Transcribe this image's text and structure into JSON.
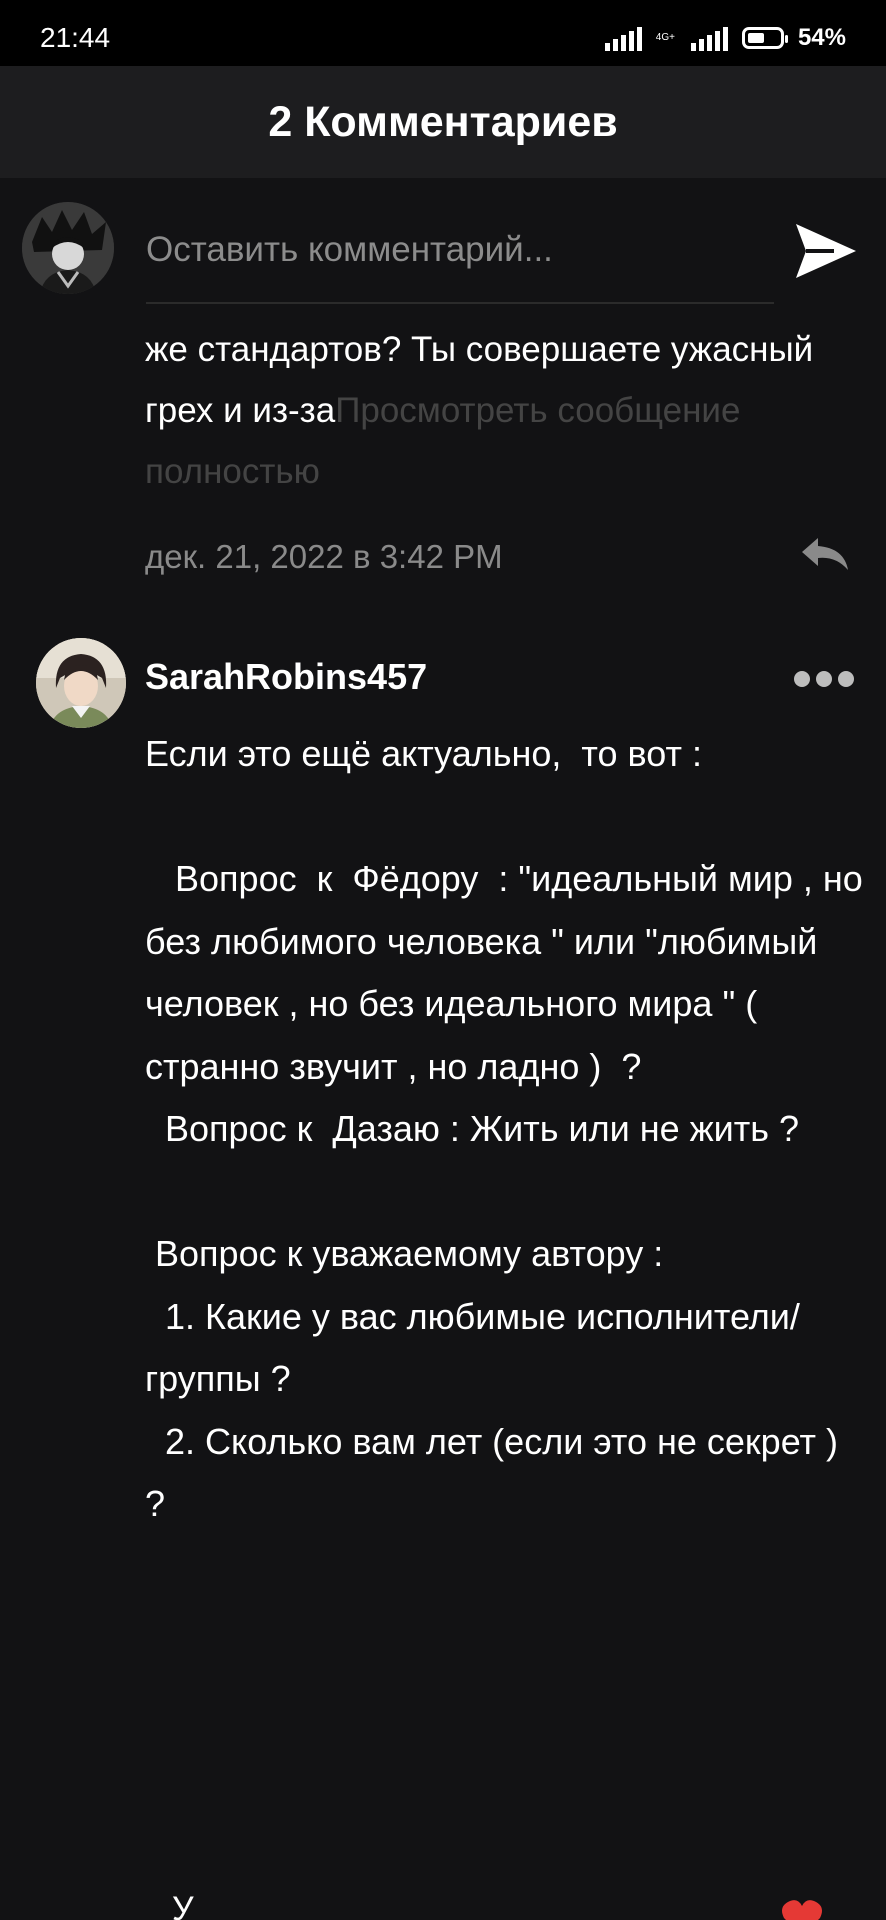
{
  "status_bar": {
    "time": "21:44",
    "network_label": "4G+",
    "battery_percent_text": "54%",
    "battery_level": 0.54
  },
  "header": {
    "title": "2 Комментариев"
  },
  "comment_input": {
    "placeholder": "Оставить комментарий..."
  },
  "previous_comment": {
    "body_partial": "же стандартов? Ты совершаете ужасный грех и из-за",
    "expand_label": "Просмотреть сообщение полностью",
    "date": "дек. 21, 2022 в 3:42 PM"
  },
  "comment": {
    "author": "SarahRobins457",
    "body": "Если это ещё актуально,  то вот :\n\n   Вопрос  к  Фёдору  : \"идеальный мир , но без любимого человека \" или \"любимый человек , но без идеального мира \" ( странно звучит , но ладно )  ?\n  Вопрос к  Дазаю : Жить или не жить ?\n\n Вопрос к уважаемому автору :\n  1. Какие у вас любимые исполнители/группы ?\n  2. Сколько вам лет (если это не секрет ) ?"
  },
  "next_item_partial": {
    "text": "У"
  },
  "colors": {
    "background": "#121214",
    "header_background": "#1d1d1f",
    "text_primary": "#ffffff",
    "text_secondary": "#8a8a8a",
    "heart": "#e53935"
  }
}
